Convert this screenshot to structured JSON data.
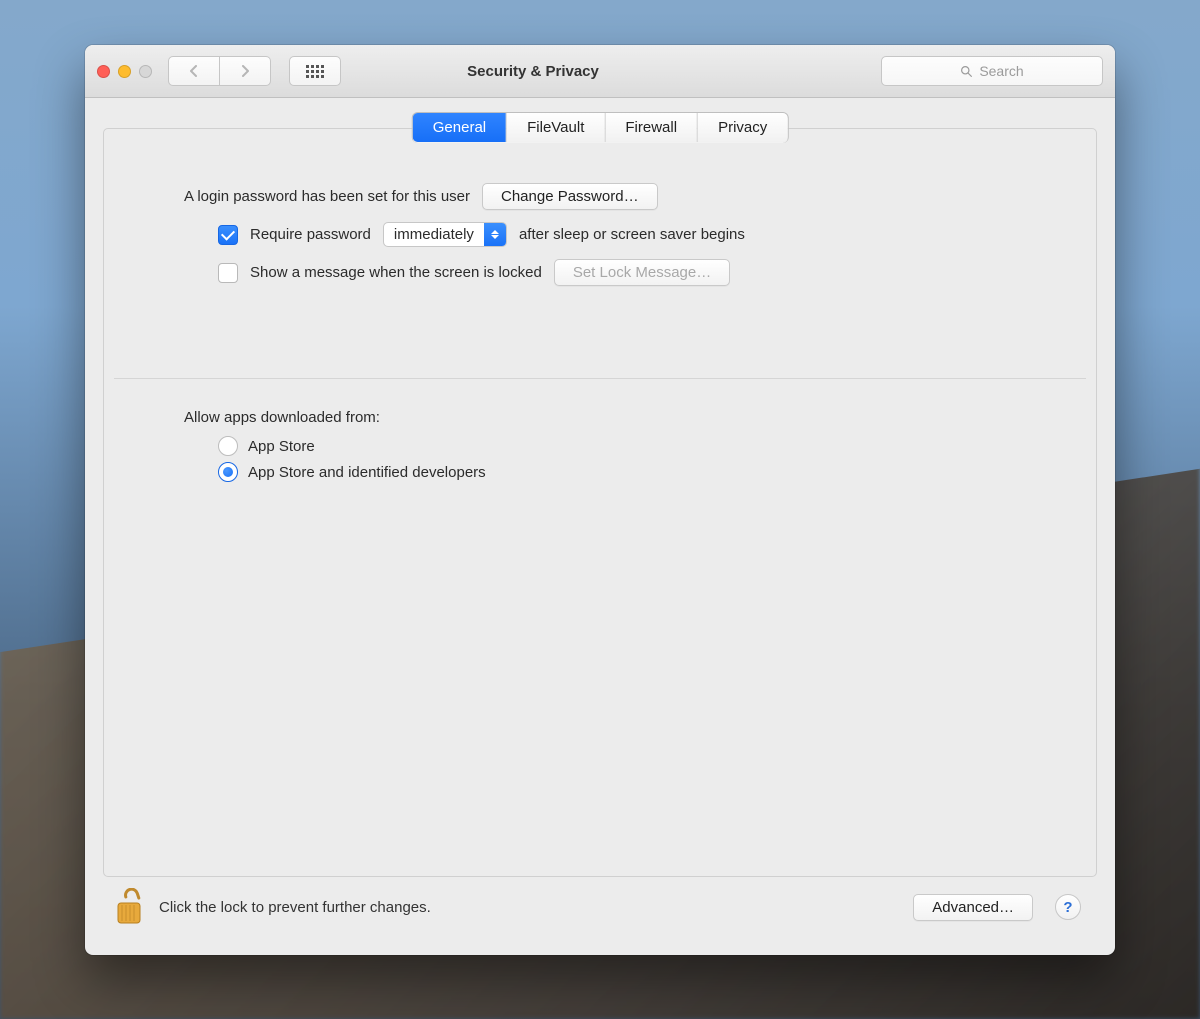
{
  "window": {
    "title": "Security & Privacy"
  },
  "toolbar": {
    "search_placeholder": "Search"
  },
  "tabs": [
    {
      "label": "General",
      "active": true
    },
    {
      "label": "FileVault",
      "active": false
    },
    {
      "label": "Firewall",
      "active": false
    },
    {
      "label": "Privacy",
      "active": false
    }
  ],
  "password": {
    "info_text": "A login password has been set for this user",
    "change_button": "Change Password…",
    "require_checkbox_checked": true,
    "require_label_before": "Require password",
    "require_delay_selected": "immediately",
    "require_label_after": "after sleep or screen saver begins",
    "show_message_checked": false,
    "show_message_label": "Show a message when the screen is locked",
    "set_lock_message_button": "Set Lock Message…"
  },
  "gatekeeper": {
    "heading": "Allow apps downloaded from:",
    "options": [
      {
        "label": "App Store",
        "selected": false
      },
      {
        "label": "App Store and identified developers",
        "selected": true
      }
    ]
  },
  "footer": {
    "lock_text": "Click the lock to prevent further changes.",
    "advanced_button": "Advanced…",
    "help_glyph": "?"
  }
}
